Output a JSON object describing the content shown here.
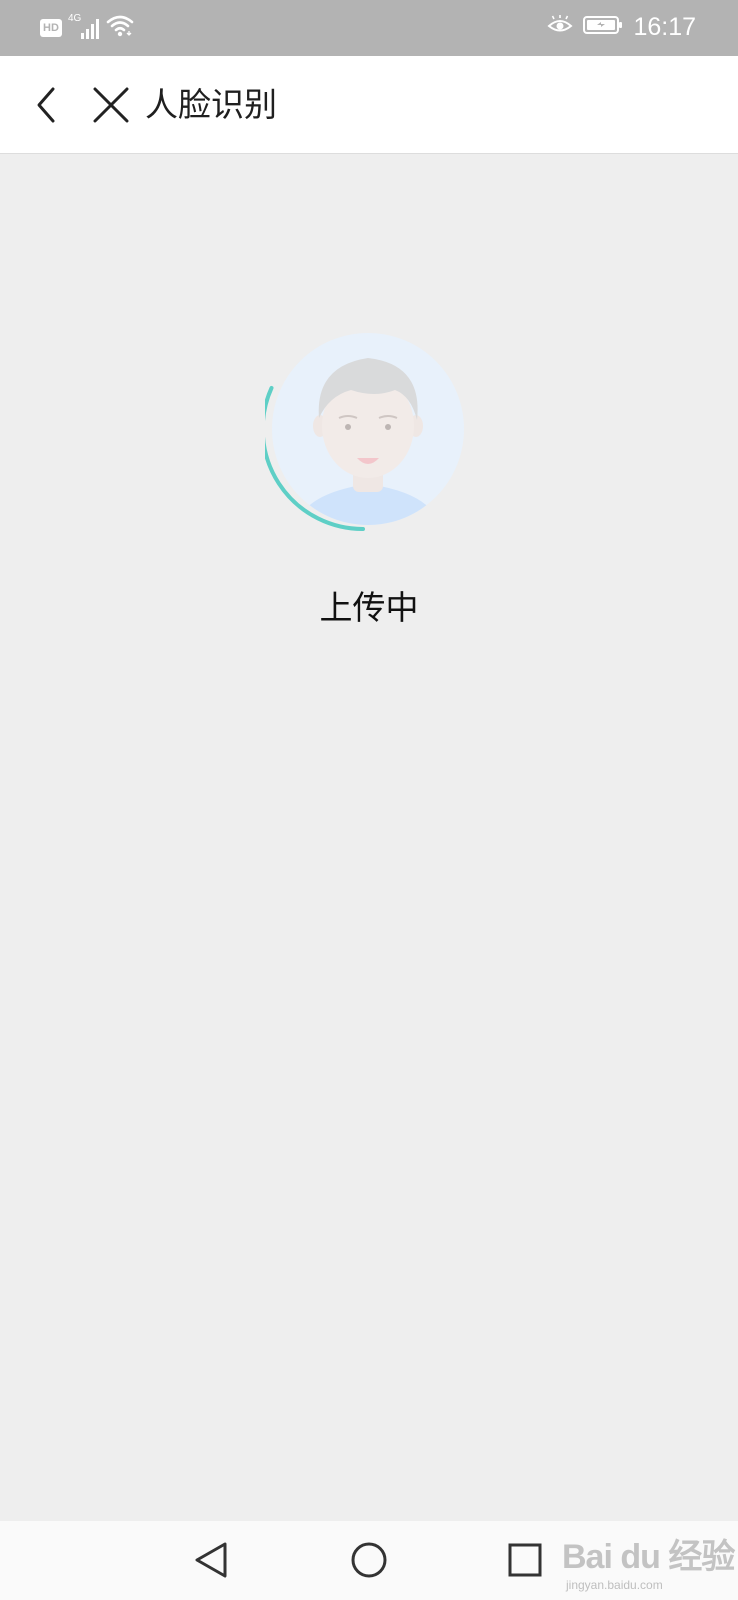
{
  "status_bar": {
    "hd_label": "HD",
    "network_label": "4G",
    "time": "16:17",
    "icons": [
      "hd-icon",
      "signal-icon",
      "wifi-icon",
      "eye-icon",
      "battery-icon"
    ]
  },
  "app_bar": {
    "title": "人脸识别",
    "back_icon": "chevron-left-icon",
    "close_icon": "close-icon"
  },
  "main": {
    "avatar_icon": "face-avatar-icon",
    "status_text": "上传中",
    "progress_color": "#5ecfc6"
  },
  "nav_bar": {
    "icons": [
      "nav-back-icon",
      "nav-home-icon",
      "nav-recent-icon"
    ]
  },
  "watermark": {
    "logo_text": "Bai du 经验",
    "sub_text": "jingyan.baidu.com"
  },
  "colors": {
    "status_bar_bg": "#b3b3b3",
    "page_bg": "#eeeeee",
    "app_bar_bg": "#ffffff",
    "accent": "#5ecfc6"
  }
}
